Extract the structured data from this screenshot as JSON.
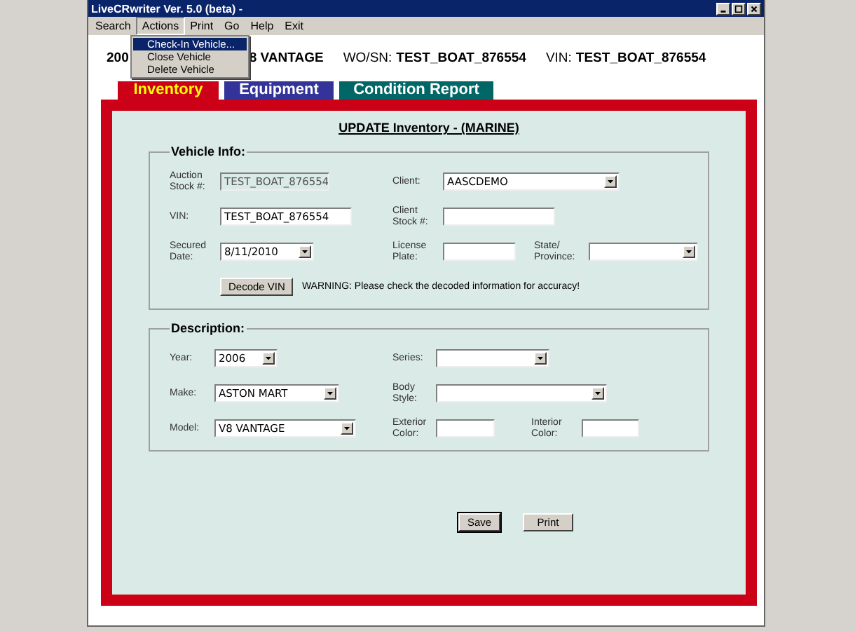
{
  "window": {
    "title": "LiveCRwriter Ver. 5.0 (beta) -"
  },
  "menu": [
    {
      "label": "Search",
      "selected": false
    },
    {
      "label": "Actions",
      "selected": true
    },
    {
      "label": "Print",
      "selected": false
    },
    {
      "label": "Go",
      "selected": false
    },
    {
      "label": "Help",
      "selected": false
    },
    {
      "label": "Exit",
      "selected": false
    }
  ],
  "dropdown": [
    {
      "label": "Check-In Vehicle...",
      "selected": true
    },
    {
      "label": "Close Vehicle",
      "selected": false
    },
    {
      "label": "Delete Vehicle",
      "selected": false
    }
  ],
  "header": {
    "vehicle_start": "200",
    "vehicle_end": "8 VANTAGE",
    "wo_label": "WO/SN:",
    "wo_value": "TEST_BOAT_876554",
    "vin_label": "VIN:",
    "vin_value": "TEST_BOAT_876554"
  },
  "tabs": [
    {
      "label": "Inventory",
      "selected": true,
      "color": "#cc0016"
    },
    {
      "label": "Equipment",
      "selected": false,
      "color": "#333399"
    },
    {
      "label": "Condition Report",
      "selected": false,
      "color": "#006666"
    }
  ],
  "form_title": "UPDATE Inventory - (MARINE)",
  "sections": [
    {
      "title": "Vehicle Info:",
      "rows": [
        {
          "fields": [
            {
              "kind": "text",
              "label": "Auction Stock #:",
              "value": "TEST_BOAT_876554",
              "disabled": true
            },
            {
              "kind": "select",
              "label": "Client:",
              "value": "AASCDEMO",
              "disabled": false
            }
          ]
        },
        {
          "fields": [
            {
              "kind": "text",
              "label": "VIN:",
              "value": "TEST_BOAT_876554",
              "disabled": false
            },
            {
              "kind": "text",
              "label": "Client Stock #:",
              "disabled": false
            }
          ]
        },
        {
          "fields": [
            {
              "kind": "select",
              "label": "Secured Date:",
              "value": "8/11/2010",
              "disabled": false
            },
            {
              "kind": "text",
              "label": "License Plate:",
              "disabled": false
            },
            {
              "kind": "select",
              "label": "State/ Province:",
              "disabled": false
            }
          ]
        },
        {
          "fields": [
            {
              "kind": "button",
              "label": "Decode VIN"
            },
            {
              "kind": "note",
              "label": "WARNING: Please check the decoded information for accuracy!"
            }
          ]
        }
      ]
    },
    {
      "title": "Description:",
      "rows": [
        {
          "fields": [
            {
              "kind": "select",
              "label": "Year:",
              "value": "2006",
              "disabled": false
            },
            {
              "kind": "select",
              "label": "Series:",
              "disabled": false
            }
          ]
        },
        {
          "fields": [
            {
              "kind": "select",
              "label": "Make:",
              "value": "ASTON MART",
              "disabled": false
            },
            {
              "kind": "select",
              "label": "Body Style:",
              "disabled": false
            }
          ]
        },
        {
          "fields": [
            {
              "kind": "select",
              "label": "Model:",
              "value": "V8 VANTAGE",
              "disabled": false
            },
            {
              "kind": "text",
              "label": "Exterior Color:",
              "disabled": false
            },
            {
              "kind": "text",
              "label": "Interior Color:",
              "disabled": false
            }
          ]
        }
      ]
    }
  ],
  "buttons": [
    {
      "label": "Save",
      "selected": true
    },
    {
      "label": "Print",
      "selected": false
    }
  ]
}
